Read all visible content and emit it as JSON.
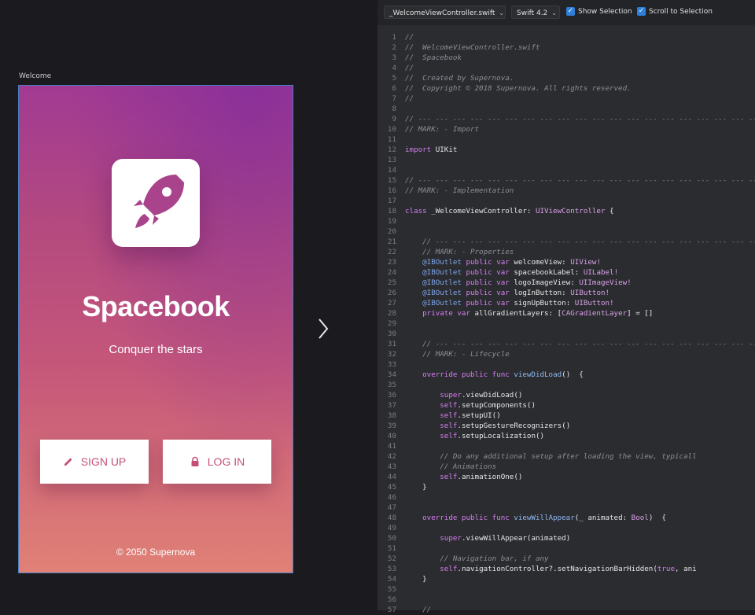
{
  "preview": {
    "artboard_label": "Welcome",
    "title": "Spacebook",
    "subtitle": "Conquer the stars",
    "signup_label": "SIGN UP",
    "login_label": "LOG IN",
    "copyright": "© 2050 Supernova"
  },
  "toolbar": {
    "file_select": "_WelcomeViewController.swift",
    "lang_select": "Swift 4.2",
    "show_selection": "Show Selection",
    "scroll_selection": "Scroll to Selection"
  },
  "code_lines": [
    {
      "n": "1",
      "segs": [
        {
          "t": "//",
          "c": "cm"
        }
      ]
    },
    {
      "n": "2",
      "segs": [
        {
          "t": "//  WelcomeViewController.swift",
          "c": "cm"
        }
      ]
    },
    {
      "n": "3",
      "segs": [
        {
          "t": "//  Spacebook",
          "c": "cm"
        }
      ]
    },
    {
      "n": "4",
      "segs": [
        {
          "t": "//",
          "c": "cm"
        }
      ]
    },
    {
      "n": "5",
      "segs": [
        {
          "t": "//  Created by Supernova.",
          "c": "cm"
        }
      ]
    },
    {
      "n": "6",
      "segs": [
        {
          "t": "//  Copyright © 2018 Supernova. All rights reserved.",
          "c": "cm"
        }
      ]
    },
    {
      "n": "7",
      "segs": [
        {
          "t": "//",
          "c": "cm"
        }
      ]
    },
    {
      "n": "8",
      "segs": []
    },
    {
      "n": "9",
      "segs": [
        {
          "t": "// --- --- --- --- --- --- --- --- --- --- --- --- --- --- --- --- --- --- --- ---",
          "c": "cm"
        }
      ]
    },
    {
      "n": "10",
      "segs": [
        {
          "t": "// MARK: - Import",
          "c": "cm"
        }
      ]
    },
    {
      "n": "11",
      "segs": []
    },
    {
      "n": "12",
      "segs": [
        {
          "t": "import",
          "c": "kw"
        },
        {
          "t": " UIKit",
          "c": ""
        }
      ]
    },
    {
      "n": "13",
      "segs": []
    },
    {
      "n": "14",
      "segs": []
    },
    {
      "n": "15",
      "segs": [
        {
          "t": "// --- --- --- --- --- --- --- --- --- --- --- --- --- --- --- --- --- --- --- ---",
          "c": "cm"
        }
      ]
    },
    {
      "n": "16",
      "segs": [
        {
          "t": "// MARK: - Implementation",
          "c": "cm"
        }
      ]
    },
    {
      "n": "17",
      "segs": []
    },
    {
      "n": "18",
      "segs": [
        {
          "t": "class",
          "c": "kw"
        },
        {
          "t": " _WelcomeViewController: ",
          "c": ""
        },
        {
          "t": "UIViewController",
          "c": "ty"
        },
        {
          "t": " {",
          "c": ""
        }
      ]
    },
    {
      "n": "19",
      "segs": []
    },
    {
      "n": "20",
      "segs": []
    },
    {
      "n": "21",
      "segs": [
        {
          "t": "    // --- --- --- --- --- --- --- --- --- --- --- --- --- --- --- --- --- --- ---",
          "c": "cm"
        }
      ]
    },
    {
      "n": "22",
      "segs": [
        {
          "t": "    // MARK: - Properties",
          "c": "cm"
        }
      ]
    },
    {
      "n": "23",
      "segs": [
        {
          "t": "    ",
          "c": ""
        },
        {
          "t": "@IBOutlet",
          "c": "at"
        },
        {
          "t": " public var",
          "c": "kw"
        },
        {
          "t": " welcomeView: ",
          "c": ""
        },
        {
          "t": "UIView!",
          "c": "ty"
        }
      ]
    },
    {
      "n": "24",
      "segs": [
        {
          "t": "    ",
          "c": ""
        },
        {
          "t": "@IBOutlet",
          "c": "at"
        },
        {
          "t": " public var",
          "c": "kw"
        },
        {
          "t": " spacebookLabel: ",
          "c": ""
        },
        {
          "t": "UILabel!",
          "c": "ty"
        }
      ]
    },
    {
      "n": "25",
      "segs": [
        {
          "t": "    ",
          "c": ""
        },
        {
          "t": "@IBOutlet",
          "c": "at"
        },
        {
          "t": " public var",
          "c": "kw"
        },
        {
          "t": " logoImageView: ",
          "c": ""
        },
        {
          "t": "UIImageView!",
          "c": "ty"
        }
      ]
    },
    {
      "n": "26",
      "segs": [
        {
          "t": "    ",
          "c": ""
        },
        {
          "t": "@IBOutlet",
          "c": "at"
        },
        {
          "t": " public var",
          "c": "kw"
        },
        {
          "t": " logInButton: ",
          "c": ""
        },
        {
          "t": "UIButton!",
          "c": "ty"
        }
      ]
    },
    {
      "n": "27",
      "segs": [
        {
          "t": "    ",
          "c": ""
        },
        {
          "t": "@IBOutlet",
          "c": "at"
        },
        {
          "t": " public var",
          "c": "kw"
        },
        {
          "t": " signUpButton: ",
          "c": ""
        },
        {
          "t": "UIButton!",
          "c": "ty"
        }
      ]
    },
    {
      "n": "28",
      "segs": [
        {
          "t": "    private var",
          "c": "kw"
        },
        {
          "t": " allGradientLayers: [",
          "c": ""
        },
        {
          "t": "CAGradientLayer",
          "c": "ty"
        },
        {
          "t": "] = []",
          "c": ""
        }
      ]
    },
    {
      "n": "29",
      "segs": []
    },
    {
      "n": "30",
      "segs": []
    },
    {
      "n": "31",
      "segs": [
        {
          "t": "    // --- --- --- --- --- --- --- --- --- --- --- --- --- --- --- --- --- --- ---",
          "c": "cm"
        }
      ]
    },
    {
      "n": "32",
      "segs": [
        {
          "t": "    // MARK: - Lifecycle",
          "c": "cm"
        }
      ]
    },
    {
      "n": "33",
      "segs": []
    },
    {
      "n": "34",
      "segs": [
        {
          "t": "    override public func",
          "c": "kw"
        },
        {
          "t": " viewDidLoad",
          "c": "fn"
        },
        {
          "t": "()  {",
          "c": ""
        }
      ]
    },
    {
      "n": "35",
      "segs": []
    },
    {
      "n": "36",
      "segs": [
        {
          "t": "        ",
          "c": ""
        },
        {
          "t": "super",
          "c": "kw"
        },
        {
          "t": ".viewDidLoad()",
          "c": ""
        }
      ]
    },
    {
      "n": "37",
      "segs": [
        {
          "t": "        ",
          "c": ""
        },
        {
          "t": "self",
          "c": "kw"
        },
        {
          "t": ".setupComponents()",
          "c": ""
        }
      ]
    },
    {
      "n": "38",
      "segs": [
        {
          "t": "        ",
          "c": ""
        },
        {
          "t": "self",
          "c": "kw"
        },
        {
          "t": ".setupUI()",
          "c": ""
        }
      ]
    },
    {
      "n": "39",
      "segs": [
        {
          "t": "        ",
          "c": ""
        },
        {
          "t": "self",
          "c": "kw"
        },
        {
          "t": ".setupGestureRecognizers()",
          "c": ""
        }
      ]
    },
    {
      "n": "40",
      "segs": [
        {
          "t": "        ",
          "c": ""
        },
        {
          "t": "self",
          "c": "kw"
        },
        {
          "t": ".setupLocalization()",
          "c": ""
        }
      ]
    },
    {
      "n": "41",
      "segs": []
    },
    {
      "n": "42",
      "segs": [
        {
          "t": "        // Do any additional setup after loading the view, typicall",
          "c": "cm"
        }
      ]
    },
    {
      "n": "43",
      "segs": [
        {
          "t": "        // Animations",
          "c": "cm"
        }
      ]
    },
    {
      "n": "44",
      "segs": [
        {
          "t": "        ",
          "c": ""
        },
        {
          "t": "self",
          "c": "kw"
        },
        {
          "t": ".animationOne()",
          "c": ""
        }
      ]
    },
    {
      "n": "45",
      "segs": [
        {
          "t": "    }",
          "c": ""
        }
      ]
    },
    {
      "n": "46",
      "segs": []
    },
    {
      "n": "47",
      "segs": []
    },
    {
      "n": "48",
      "segs": [
        {
          "t": "    override public func",
          "c": "kw"
        },
        {
          "t": " viewWillAppear",
          "c": "fn"
        },
        {
          "t": "(_ animated: ",
          "c": ""
        },
        {
          "t": "Bool",
          "c": "ty"
        },
        {
          "t": ")  {",
          "c": ""
        }
      ]
    },
    {
      "n": "49",
      "segs": []
    },
    {
      "n": "50",
      "segs": [
        {
          "t": "        ",
          "c": ""
        },
        {
          "t": "super",
          "c": "kw"
        },
        {
          "t": ".viewWillAppear(animated)",
          "c": ""
        }
      ]
    },
    {
      "n": "51",
      "segs": []
    },
    {
      "n": "52",
      "segs": [
        {
          "t": "        // Navigation bar, if any",
          "c": "cm"
        }
      ]
    },
    {
      "n": "53",
      "segs": [
        {
          "t": "        ",
          "c": ""
        },
        {
          "t": "self",
          "c": "kw"
        },
        {
          "t": ".navigationController?.setNavigationBarHidden(",
          "c": ""
        },
        {
          "t": "true",
          "c": "kw"
        },
        {
          "t": ", ani",
          "c": ""
        }
      ]
    },
    {
      "n": "54",
      "segs": [
        {
          "t": "    }",
          "c": ""
        }
      ]
    },
    {
      "n": "55",
      "segs": []
    },
    {
      "n": "56",
      "segs": []
    },
    {
      "n": "57",
      "segs": [
        {
          "t": "    //",
          "c": "cm"
        }
      ]
    }
  ]
}
